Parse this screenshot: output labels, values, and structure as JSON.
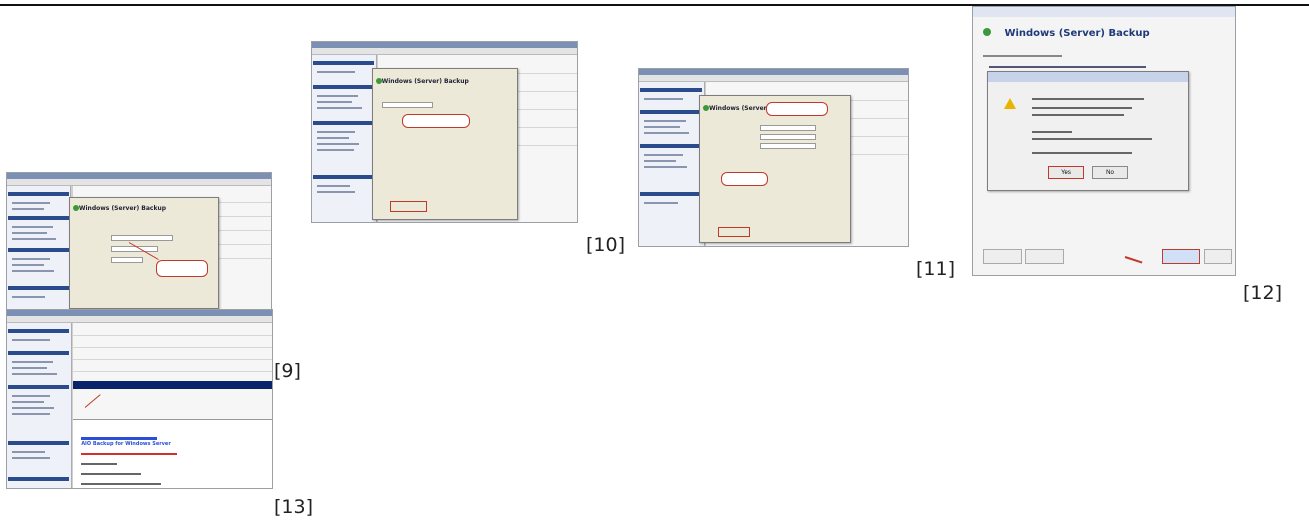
{
  "figures": [
    {
      "caption": "[9]"
    },
    {
      "caption": "[10]",
      "dialog_title": "Windows (Server) Backup"
    },
    {
      "caption": "[11]",
      "dialog_title": "Windows (Server) Backup"
    },
    {
      "caption": "[12]",
      "dialog_title": "Windows (Server) Backup",
      "yes_label": "Yes",
      "no_label": "No"
    },
    {
      "caption": "[13]",
      "info_title": "AIO Backup for Windows Server"
    }
  ],
  "colors": {
    "annotation_red": "#c0392b",
    "title_bar": "#7c8fb4",
    "selection": "#0a246a"
  }
}
